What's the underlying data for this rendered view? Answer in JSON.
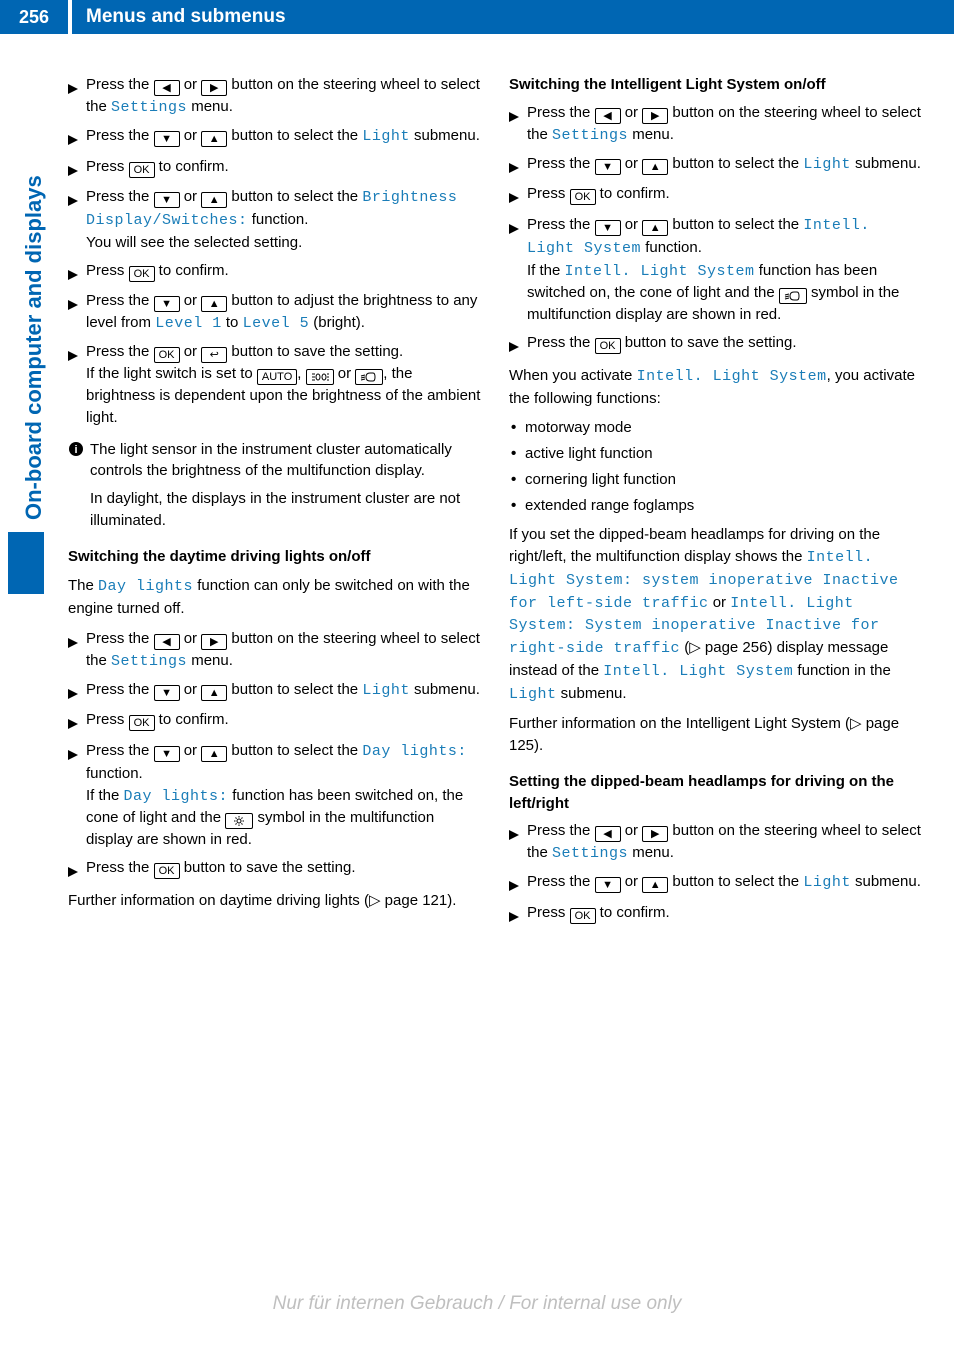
{
  "page_number": "256",
  "header_title": "Menus and submenus",
  "side_tab": "On-board computer and displays",
  "watermark": "Nur für internen Gebrauch / For internal use only",
  "btn": {
    "left": "◀",
    "right": "▶",
    "down": "▼",
    "up": "▲",
    "ok": "OK",
    "back": "↩",
    "auto": "AUTO"
  },
  "mono": {
    "settings": "Settings",
    "light": "Light",
    "brightness_fn": "Brightness Display/Switches:",
    "level1": "Level 1",
    "level5": "Level 5",
    "day_lights": "Day lights",
    "day_lights_fn": "Day lights:",
    "intell": "Intell. Light System",
    "msg_left": "Intell. Light System: system inoperative Inactive for left-side traffic",
    "msg_right": "Intell. Light System: System inoperative Inactive for right-side traffic"
  },
  "left": {
    "s1a": "Press the ",
    "s1b": " or ",
    "s1c": " button on the steering wheel to select the ",
    "s1d": " menu.",
    "s2a": "Press the ",
    "s2b": " or ",
    "s2c": " button to select the ",
    "s2d": " submenu.",
    "s3a": "Press ",
    "s3b": " to confirm.",
    "s4a": "Press the ",
    "s4b": " or ",
    "s4c": " button to select the ",
    "s4d": " function.",
    "s4e": "You will see the selected setting.",
    "s6a": "Press the ",
    "s6b": " or ",
    "s6c": " button to adjust the brightness to any level from ",
    "s6d": " to ",
    "s6e": " (bright).",
    "s7a": "Press the ",
    "s7b": " or ",
    "s7c": " button to save the setting.",
    "s7d": "If the light switch is set to ",
    "s7e": ", ",
    "s7f": " or ",
    "s7g": ", the brightness is dependent upon the brightness of the ambient light.",
    "info1": "The light sensor in the instrument cluster automatically controls the brightness of the multifunction display.",
    "info2": "In daylight, the displays in the instrument cluster are not illuminated.",
    "h_day": "Switching the daytime driving lights on/off",
    "p_day": "The ",
    "p_day2": " function can only be switched on with the engine turned off.",
    "d4d": " function.",
    "d4e1": "If the ",
    "d4e2": " function has been switched on, the cone of light and the ",
    "d4e3": " symbol in the multifunction display are shown in red.",
    "d5a": "Press the ",
    "d5b": " button to save the setting.",
    "p_more": "Further information on daytime driving lights (▷ page 121)."
  },
  "right": {
    "h_ils": "Switching the Intelligent Light System on/off",
    "i4a": " function.",
    "i4b1": "If the ",
    "i4b2": " function has been switched on, the cone of light and the ",
    "i4b3": " symbol in the multifunction display are shown in red.",
    "i5a": "Press the ",
    "i5b": " button to save the setting.",
    "p_act1": "When you activate ",
    "p_act2": ", you activate the following functions:",
    "b1": "motorway mode",
    "b2": "active light function",
    "b3": "cornering light function",
    "b4": "extended range foglamps",
    "p_msg1": "If you set the dipped-beam headlamps for driving on the right/left, the multifunction display shows the ",
    "p_msg_or": " or ",
    "p_msg2": " (▷ page 256) display message instead of the ",
    "p_msg3": " function in the ",
    "p_msg4": " submenu.",
    "p_more": "Further information on the Intelligent Light System (▷ page 125).",
    "h_dipped": "Setting the dipped-beam headlamps for driving on the left/right"
  }
}
